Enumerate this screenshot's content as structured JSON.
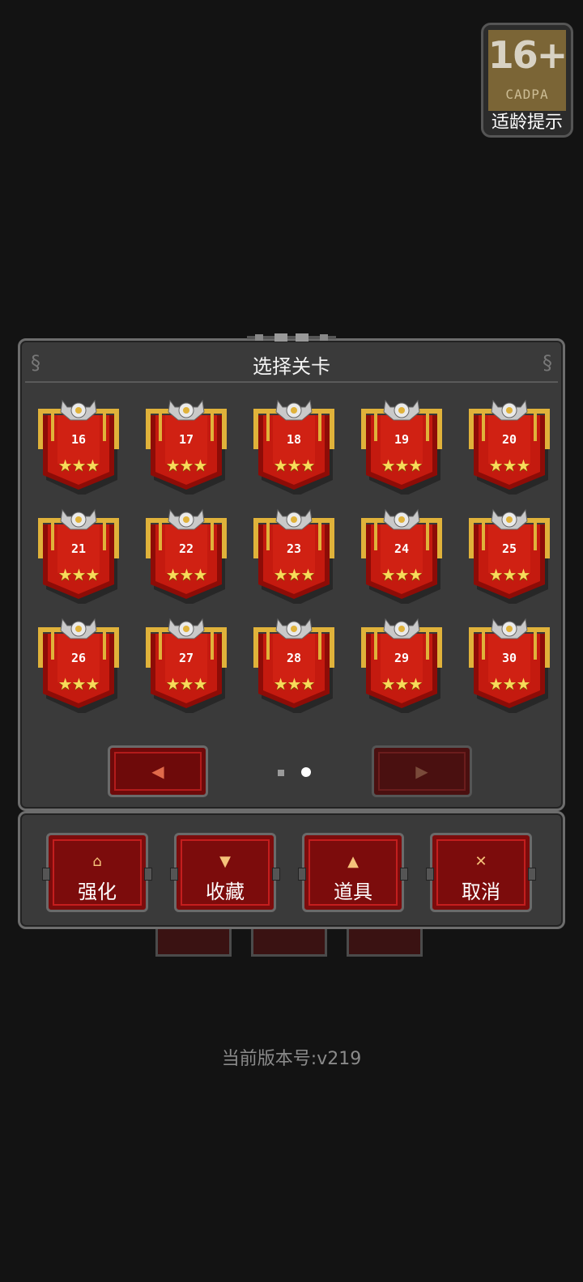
{
  "age_rating": {
    "age": "16+",
    "org": "CADPA",
    "tip": "适龄提示"
  },
  "dialog": {
    "title": "选择关卡",
    "levels": [
      {
        "num": "16",
        "stars": 3
      },
      {
        "num": "17",
        "stars": 3
      },
      {
        "num": "18",
        "stars": 3
      },
      {
        "num": "19",
        "stars": 3
      },
      {
        "num": "20",
        "stars": 3
      },
      {
        "num": "21",
        "stars": 3
      },
      {
        "num": "22",
        "stars": 3
      },
      {
        "num": "23",
        "stars": 3
      },
      {
        "num": "24",
        "stars": 3
      },
      {
        "num": "25",
        "stars": 3
      },
      {
        "num": "26",
        "stars": 3
      },
      {
        "num": "27",
        "stars": 3
      },
      {
        "num": "28",
        "stars": 3
      },
      {
        "num": "29",
        "stars": 3
      },
      {
        "num": "30",
        "stars": 3
      }
    ],
    "pagination": {
      "current_page": 2,
      "total_pages": 2
    },
    "prev_arrow": "◀",
    "next_arrow": "▶"
  },
  "actions": [
    {
      "label": "强化",
      "icon": "upgrade-icon",
      "glyph": "⌂"
    },
    {
      "label": "收藏",
      "icon": "chalice-icon",
      "glyph": "▼"
    },
    {
      "label": "道具",
      "icon": "potion-icon",
      "glyph": "▲"
    },
    {
      "label": "取消",
      "icon": "close-icon",
      "glyph": "✕"
    }
  ],
  "version_text": "当前版本号:v219",
  "colors": {
    "banner_red": "#c41a0f",
    "banner_dark": "#8d0c07",
    "star": "#f8da5a",
    "gold": "#e0b23a",
    "panel": "#3a3a3a"
  }
}
